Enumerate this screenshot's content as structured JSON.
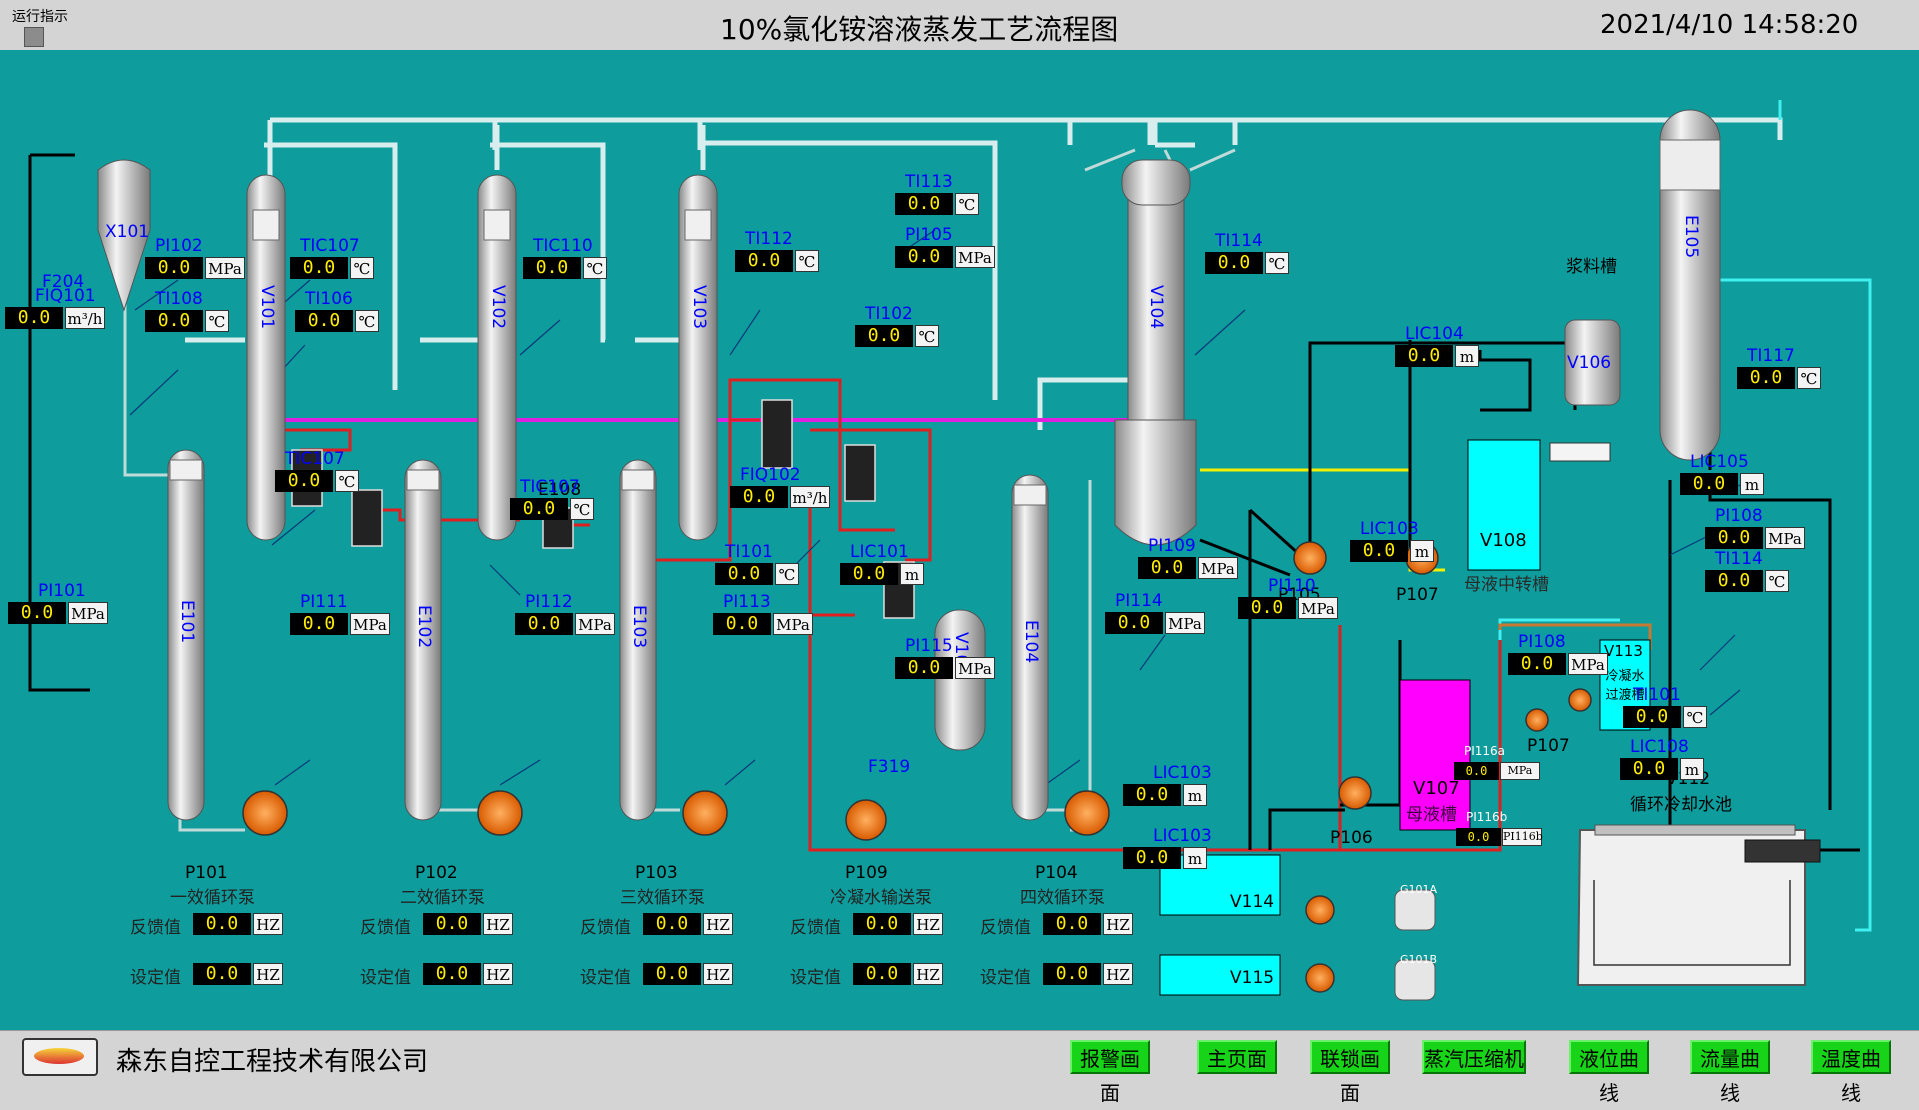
{
  "header": {
    "run_indicator_label": "运行指示",
    "title": "10%氯化铵溶液蒸发工艺流程图",
    "datetime": "2021/4/10 14:58:20"
  },
  "footer": {
    "company": "森东自控工程技术有限公司",
    "buttons": [
      "报警画面",
      "主页面",
      "联锁画面",
      "蒸汽压缩机",
      "液位曲线",
      "流量曲线",
      "温度曲线"
    ]
  },
  "vessels": {
    "X101": "X101",
    "V101": "V101",
    "V102": "V102",
    "V103": "V103",
    "V104": "V104",
    "V105": "V105",
    "E101": "E101",
    "E102": "E102",
    "E103": "E103",
    "E104": "E104",
    "E105": "E105",
    "E108": "E108",
    "V106": "V106",
    "V108": "V108",
    "V107": "V107",
    "V113": "V113",
    "V114": "V114",
    "V115": "V115",
    "V112": "V112",
    "slurry_tank": "浆料槽",
    "V108_desc": "母液中转槽",
    "V107_desc": "母液槽",
    "V113_desc": "冷凝水过渡槽",
    "V112_desc": "循环冷却水池"
  },
  "valves": {
    "F204": "F204",
    "F319": "F319"
  },
  "pumps_tags": {
    "P105": "P105",
    "P107": "P107",
    "P107b": "P107",
    "P106": "P106",
    "G101A": "G101A",
    "G101B": "G101B"
  },
  "instruments": [
    {
      "tag": "PI102",
      "value": "0.0",
      "unit": "MPa"
    },
    {
      "tag": "TIC107",
      "value": "0.0",
      "unit": "℃"
    },
    {
      "tag": "TIC110",
      "value": "0.0",
      "unit": "℃"
    },
    {
      "tag": "TI112",
      "value": "0.0",
      "unit": "℃"
    },
    {
      "tag": "TI113",
      "value": "0.0",
      "unit": "℃"
    },
    {
      "tag": "PI105",
      "value": "0.0",
      "unit": "MPa"
    },
    {
      "tag": "TI114",
      "value": "0.0",
      "unit": "℃"
    },
    {
      "tag": "FIQ101",
      "value": "0.0",
      "unit": "m³/h"
    },
    {
      "tag": "TI108",
      "value": "0.0",
      "unit": "℃"
    },
    {
      "tag": "TI106",
      "value": "0.0",
      "unit": "℃"
    },
    {
      "tag": "TI102",
      "value": "0.0",
      "unit": "℃"
    },
    {
      "tag": "LIC104",
      "value": "0.0",
      "unit": "m"
    },
    {
      "tag": "TI117",
      "value": "0.0",
      "unit": "℃"
    },
    {
      "tag": "TIC107",
      "value": "0.0",
      "unit": "℃"
    },
    {
      "tag": "TIC107",
      "value": "0.0",
      "unit": "℃"
    },
    {
      "tag": "FIQ102",
      "value": "0.0",
      "unit": "m³/h"
    },
    {
      "tag": "LIC105",
      "value": "0.0",
      "unit": "m"
    },
    {
      "tag": "LIC103",
      "value": "0.0",
      "unit": "m"
    },
    {
      "tag": "PI108",
      "value": "0.0",
      "unit": "MPa"
    },
    {
      "tag": "TI114",
      "value": "0.0",
      "unit": "℃"
    },
    {
      "tag": "PI109",
      "value": "0.0",
      "unit": "MPa"
    },
    {
      "tag": "TI101",
      "value": "0.0",
      "unit": "℃"
    },
    {
      "tag": "LIC101",
      "value": "0.0",
      "unit": "m"
    },
    {
      "tag": "PI101",
      "value": "0.0",
      "unit": "MPa"
    },
    {
      "tag": "PI111",
      "value": "0.0",
      "unit": "MPa"
    },
    {
      "tag": "PI112",
      "value": "0.0",
      "unit": "MPa"
    },
    {
      "tag": "PI113",
      "value": "0.0",
      "unit": "MPa"
    },
    {
      "tag": "PI114",
      "value": "0.0",
      "unit": "MPa"
    },
    {
      "tag": "PI110",
      "value": "0.0",
      "unit": "MPa"
    },
    {
      "tag": "PI115",
      "value": "0.0",
      "unit": "MPa"
    },
    {
      "tag": "PI108",
      "value": "0.0",
      "unit": "MPa"
    },
    {
      "tag": "TI101",
      "value": "0.0",
      "unit": "℃"
    },
    {
      "tag": "LIC108",
      "value": "0.0",
      "unit": "m"
    },
    {
      "tag": "LIC103",
      "value": "0.0",
      "unit": "m"
    },
    {
      "tag": "LIC103",
      "value": "0.0",
      "unit": "m"
    },
    {
      "tag": "PI116a",
      "value": "0.0",
      "unit": "MPa"
    },
    {
      "tag": "PI116b",
      "value": "0.0",
      "unit": "PI116b"
    }
  ],
  "pump_panels": [
    {
      "tag": "P101",
      "name": "一效循环泵",
      "feedback_label": "反馈值",
      "setpoint_label": "设定值",
      "feedback": "0.0",
      "setpoint": "0.0",
      "unit": "HZ"
    },
    {
      "tag": "P102",
      "name": "二效循环泵",
      "feedback_label": "反馈值",
      "setpoint_label": "设定值",
      "feedback": "0.0",
      "setpoint": "0.0",
      "unit": "HZ"
    },
    {
      "tag": "P103",
      "name": "三效循环泵",
      "feedback_label": "反馈值",
      "setpoint_label": "设定值",
      "feedback": "0.0",
      "setpoint": "0.0",
      "unit": "HZ"
    },
    {
      "tag": "P109",
      "name": "冷凝水输送泵",
      "feedback_label": "反馈值",
      "setpoint_label": "设定值",
      "feedback": "0.0",
      "setpoint": "0.0",
      "unit": "HZ"
    },
    {
      "tag": "P104",
      "name": "四效循环泵",
      "feedback_label": "反馈值",
      "setpoint_label": "设定值",
      "feedback": "0.0",
      "setpoint": "0.0",
      "unit": "HZ"
    }
  ],
  "colors": {
    "background": "#0e9c9c",
    "pipe_steam": "#c8e8e8",
    "pipe_red": "#e02020",
    "pipe_magenta": "#e020e0",
    "pipe_yellow": "#f0f000",
    "pipe_black": "#000000",
    "pipe_cyan": "#40f0f0",
    "tank_cyan": "#00ffff",
    "tank_magenta": "#ff00ff",
    "button_green": "#18d418"
  }
}
